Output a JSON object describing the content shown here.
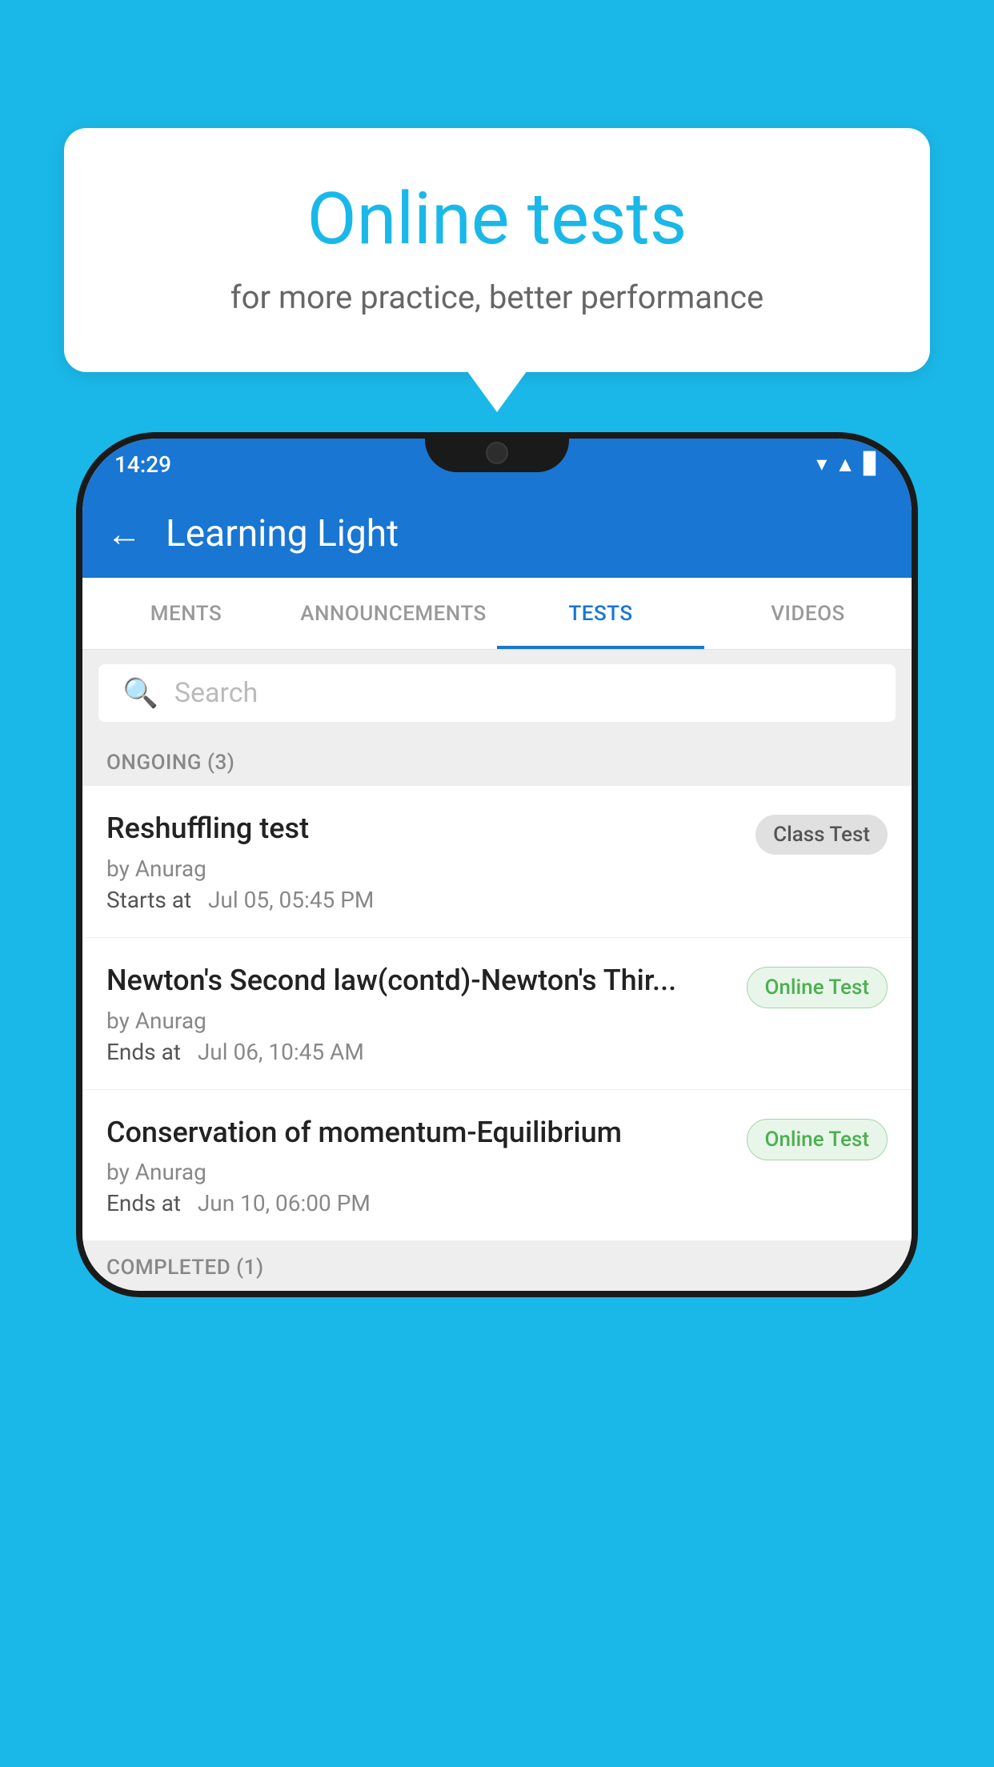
{
  "background": {
    "color": "#1ab8e8"
  },
  "speech_bubble": {
    "title": "Online tests",
    "subtitle": "for more practice, better performance"
  },
  "phone": {
    "status_bar": {
      "time": "14:29",
      "wifi_icon": "▼",
      "signal_icon": "▲",
      "battery_icon": "▊"
    },
    "app_bar": {
      "back_label": "←",
      "title": "Learning Light"
    },
    "tabs": [
      {
        "label": "MENTS",
        "active": false
      },
      {
        "label": "ANNOUNCEMENTS",
        "active": false
      },
      {
        "label": "TESTS",
        "active": true
      },
      {
        "label": "VIDEOS",
        "active": false
      }
    ],
    "search": {
      "placeholder": "Search"
    },
    "ongoing_section": {
      "label": "ONGOING (3)"
    },
    "tests": [
      {
        "title": "Reshuffling test",
        "author": "by Anurag",
        "time_label": "Starts at",
        "time_value": "Jul 05, 05:45 PM",
        "badge": "Class Test",
        "badge_type": "class"
      },
      {
        "title": "Newton's Second law(contd)-Newton's Thir...",
        "author": "by Anurag",
        "time_label": "Ends at",
        "time_value": "Jul 06, 10:45 AM",
        "badge": "Online Test",
        "badge_type": "online"
      },
      {
        "title": "Conservation of momentum-Equilibrium",
        "author": "by Anurag",
        "time_label": "Ends at",
        "time_value": "Jun 10, 06:00 PM",
        "badge": "Online Test",
        "badge_type": "online"
      }
    ],
    "completed_section": {
      "label": "COMPLETED (1)"
    }
  }
}
